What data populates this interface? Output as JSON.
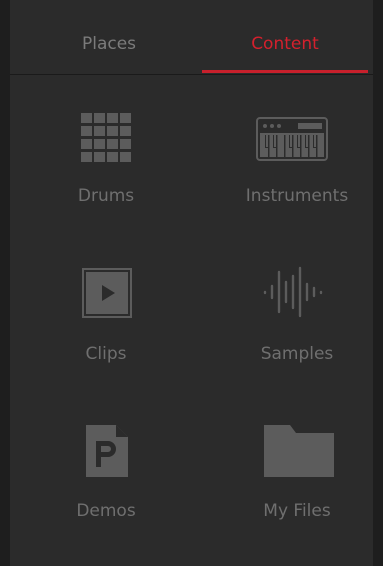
{
  "tabs": {
    "places": "Places",
    "content": "Content",
    "active": "content"
  },
  "tiles": [
    {
      "label": "Drums",
      "icon": "drum-pads-icon"
    },
    {
      "label": "Instruments",
      "icon": "keyboard-icon"
    },
    {
      "label": "Clips",
      "icon": "clip-play-icon"
    },
    {
      "label": "Samples",
      "icon": "waveform-icon"
    },
    {
      "label": "Demos",
      "icon": "demo-document-icon"
    },
    {
      "label": "My Files",
      "icon": "folder-icon"
    }
  ],
  "colors": {
    "accent": "#d4202d",
    "background": "#2b2b2b",
    "icon": "#5c5c5c",
    "label": "#6f6f6f"
  }
}
